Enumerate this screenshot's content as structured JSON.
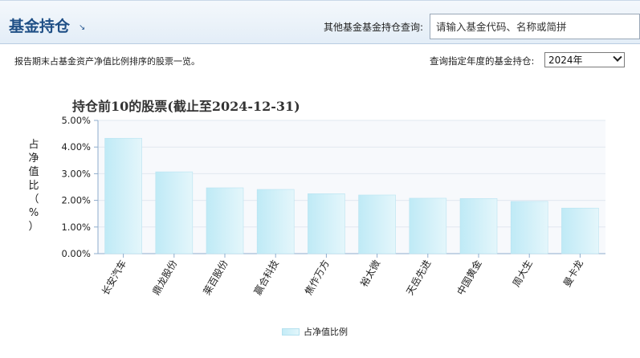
{
  "header": {
    "title": "基金持仓",
    "search_label": "其他基金基金持仓查询:",
    "search_placeholder": "请输入基金代码、名称或简拼"
  },
  "subbar": {
    "description": "报告期末占基金资产净值比例排序的股票一览。",
    "year_label": "查询指定年度的基金持仓:",
    "year_selected": "2024年"
  },
  "colors": {
    "header_title": "#1f4f86",
    "bar_fill": "#c4ecf7",
    "axis": "#8eaccc"
  },
  "chart_data": {
    "type": "bar",
    "title": "持仓前10的股票(截止至2024-12-31)",
    "ylabel": "占净值比（%）",
    "ylim": [
      0,
      5
    ],
    "y_ticks": [
      "0.00%",
      "1.00%",
      "2.00%",
      "3.00%",
      "4.00%",
      "5.00%"
    ],
    "categories": [
      "长安汽车",
      "鼎龙股份",
      "莱百股份",
      "赢合科技",
      "焦作万方",
      "裕太微",
      "天岳先进",
      "中国黄金",
      "周大生",
      "曼卡龙"
    ],
    "series": [
      {
        "name": "占净值比例",
        "values": [
          4.33,
          3.07,
          2.47,
          2.41,
          2.25,
          2.2,
          2.08,
          2.07,
          1.96,
          1.71
        ]
      }
    ],
    "legend_position": "bottom",
    "grid": true
  }
}
